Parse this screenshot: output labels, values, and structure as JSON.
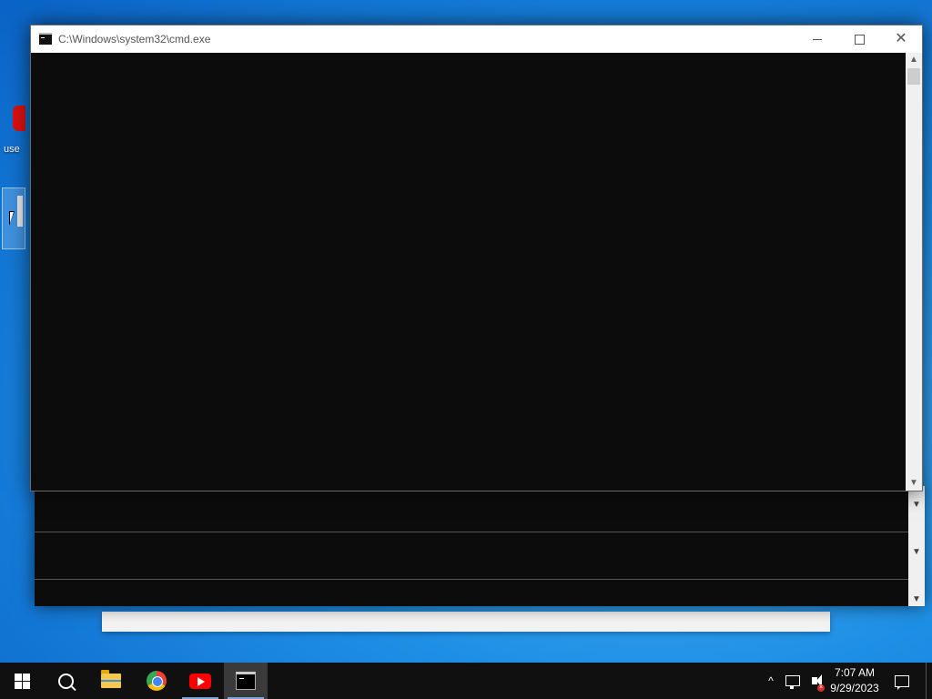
{
  "window": {
    "title": "C:\\Windows\\system32\\cmd.exe",
    "icon": "cmd-icon",
    "controls": [
      "minimize-icon",
      "maximize-icon",
      "close-icon"
    ]
  },
  "console": {
    "text": ""
  },
  "desktop": {
    "icon_label_fragment": "use"
  },
  "taskbar": {
    "items": [
      {
        "name": "start",
        "icon": "windows-logo-icon"
      },
      {
        "name": "search",
        "icon": "search-icon"
      },
      {
        "name": "file-explorer",
        "icon": "folder-icon"
      },
      {
        "name": "chrome",
        "icon": "chrome-icon"
      },
      {
        "name": "youtube",
        "icon": "youtube-icon"
      },
      {
        "name": "command-prompt",
        "icon": "cmd-icon",
        "active": true
      }
    ],
    "tray": {
      "time": "7:07 AM",
      "date": "9/29/2023",
      "icons": [
        "chevron-up-icon",
        "network-icon",
        "volume-muted-icon",
        "notification-icon"
      ]
    }
  },
  "colors": {
    "console_bg": "#0c0c0c",
    "taskbar_bg": "#101010",
    "desktop_blue": "#1e8fe6"
  }
}
